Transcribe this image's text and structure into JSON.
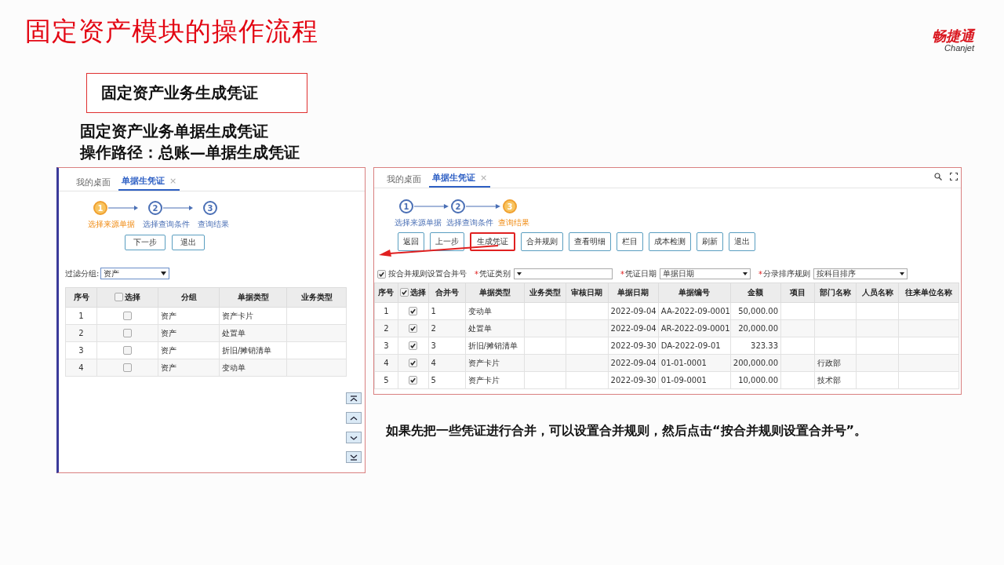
{
  "slide": {
    "title": "固定资产模块的操作流程",
    "logo": {
      "name": "畅捷通",
      "latin": "Chanjet"
    },
    "section_label": "固定资产业务生成凭证",
    "heading": "固定资产业务单据生成凭证",
    "path": "操作路径：总账—单据生成凭证",
    "note": "如果先把一些凭证进行合并，可以设置合并规则，然后点击“按合并规则设置合并号”。"
  },
  "left_screen": {
    "tabs": [
      {
        "label": "我的桌面",
        "selected": false
      },
      {
        "label": "单据生凭证",
        "selected": true,
        "close": "×"
      }
    ],
    "steps": [
      {
        "number": "1",
        "label": "选择来源单据",
        "selected": true
      },
      {
        "number": "2",
        "label": "选择查询条件",
        "selected": false
      },
      {
        "number": "3",
        "label": "查询结果",
        "selected": false
      }
    ],
    "buttons": [
      {
        "label": "下一步",
        "highlighted": false
      },
      {
        "label": "退出",
        "highlighted": false
      }
    ],
    "filter": {
      "label": "过滤分组:",
      "value": "资产"
    },
    "table": {
      "columns": [
        {
          "label": "序号",
          "kind": "index"
        },
        {
          "label": "选择",
          "kind": "check"
        },
        {
          "label": "分组",
          "kind": "text"
        },
        {
          "label": "单据类型",
          "kind": "text"
        },
        {
          "label": "业务类型",
          "kind": "text"
        }
      ],
      "select_all_checked": false,
      "rows": [
        {
          "checked": false,
          "cells": [
            "1",
            "",
            "资产",
            "资产卡片",
            ""
          ]
        },
        {
          "checked": false,
          "cells": [
            "2",
            "",
            "资产",
            "处置单",
            ""
          ]
        },
        {
          "checked": false,
          "cells": [
            "3",
            "",
            "资产",
            "折旧/摊销清单",
            ""
          ]
        },
        {
          "checked": false,
          "cells": [
            "4",
            "",
            "资产",
            "变动单",
            ""
          ]
        }
      ]
    }
  },
  "right_screen": {
    "tabs": [
      {
        "label": "我的桌面",
        "selected": false
      },
      {
        "label": "单据生凭证",
        "selected": true,
        "close": "×"
      }
    ],
    "steps": [
      {
        "number": "1",
        "label": "选择来源单据",
        "selected": false
      },
      {
        "number": "2",
        "label": "选择查询条件",
        "selected": false
      },
      {
        "number": "3",
        "label": "查询结果",
        "selected": true
      }
    ],
    "buttons": [
      {
        "label": "返回",
        "highlighted": false
      },
      {
        "label": "上一步",
        "highlighted": false
      },
      {
        "label": "生成凭证",
        "highlighted": true
      },
      {
        "label": "合并规则",
        "highlighted": false
      },
      {
        "label": "查看明细",
        "highlighted": false
      },
      {
        "label": "栏目",
        "highlighted": false
      },
      {
        "label": "成本检测",
        "highlighted": false
      },
      {
        "label": "刷新",
        "highlighted": false
      },
      {
        "label": "退出",
        "highlighted": false
      }
    ],
    "merge_option": {
      "label": "按合并规则设置合并号",
      "checked": true
    },
    "fields": [
      {
        "required_mark": "*",
        "label": "凭证类别"
      },
      {
        "required_mark": "*",
        "label": "凭证日期",
        "value": "单据日期"
      },
      {
        "required_mark": "*",
        "label": "分录排序规则",
        "value": "按科目排序"
      }
    ],
    "table": {
      "columns": [
        {
          "label": "序号",
          "kind": "index"
        },
        {
          "label": "选择",
          "kind": "check"
        },
        {
          "label": "合并号",
          "kind": "text"
        },
        {
          "label": "单据类型",
          "kind": "text"
        },
        {
          "label": "业务类型",
          "kind": "text"
        },
        {
          "label": "审核日期",
          "kind": "text"
        },
        {
          "label": "单据日期",
          "kind": "text"
        },
        {
          "label": "单据编号",
          "kind": "text"
        },
        {
          "label": "金额",
          "kind": "number"
        },
        {
          "label": "项目",
          "kind": "text"
        },
        {
          "label": "部门名称",
          "kind": "text"
        },
        {
          "label": "人员名称",
          "kind": "text"
        },
        {
          "label": "往来单位名称",
          "kind": "text"
        }
      ],
      "select_all_checked": true,
      "rows": [
        {
          "checked": true,
          "cells": [
            "1",
            "",
            "1",
            "变动单",
            "",
            "",
            "2022-09-04",
            "AA-2022-09-0001",
            "50,000.00",
            "",
            "",
            "",
            ""
          ]
        },
        {
          "checked": true,
          "cells": [
            "2",
            "",
            "2",
            "处置单",
            "",
            "",
            "2022-09-04",
            "AR-2022-09-0001",
            "20,000.00",
            "",
            "",
            "",
            ""
          ]
        },
        {
          "checked": true,
          "cells": [
            "3",
            "",
            "3",
            "折旧/摊销清单",
            "",
            "",
            "2022-09-30",
            "DA-2022-09-01",
            "323.33",
            "",
            "",
            "",
            ""
          ]
        },
        {
          "checked": true,
          "cells": [
            "4",
            "",
            "4",
            "资产卡片",
            "",
            "",
            "2022-09-04",
            "01-01-0001",
            "200,000.00",
            "",
            "行政部",
            "",
            ""
          ]
        },
        {
          "checked": true,
          "cells": [
            "5",
            "",
            "5",
            "资产卡片",
            "",
            "",
            "2022-09-30",
            "01-09-0001",
            "10,000.00",
            "",
            "技术部",
            "",
            ""
          ]
        }
      ]
    }
  }
}
